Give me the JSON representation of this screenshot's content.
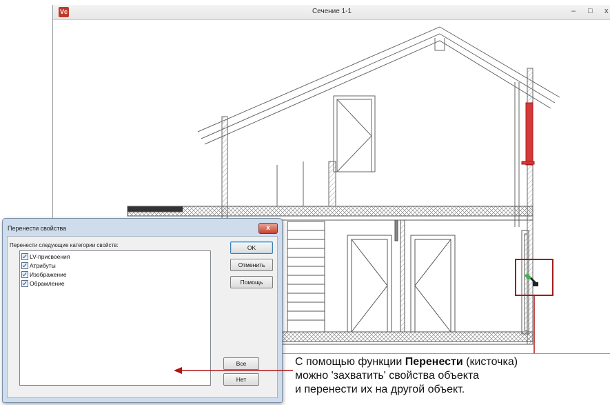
{
  "window": {
    "title": "Сечение 1-1",
    "logo": "Vc",
    "controls": [
      "–",
      "□",
      "x"
    ]
  },
  "dialog": {
    "title": "Перенести свойства",
    "close_symbol": "x",
    "categories_label": "Перенести следующие категории свойств:",
    "categories": [
      {
        "label": "LV-присвоения",
        "checked": true
      },
      {
        "label": "Атрибуты",
        "checked": true
      },
      {
        "label": "Изображение",
        "checked": true
      },
      {
        "label": "Обрамление",
        "checked": true
      }
    ],
    "buttons": {
      "ok": "OK",
      "cancel": "Отменить",
      "help": "Помощь",
      "all": "Все",
      "none": "Нет"
    }
  },
  "annotation": {
    "line1_pre": "С помощью функции ",
    "line1_bold": "Перенести",
    "line1_post": " (кисточка)",
    "line2": "можно 'захватить' свойства объекта",
    "line3": "и перенести их на другой объект."
  },
  "colors": {
    "highlight_red": "#c0392b",
    "arrow_red": "#b01515"
  },
  "icons": [
    "app-logo",
    "minimize-icon",
    "maximize-icon",
    "close-icon",
    "checkbox-icon",
    "brush-cursor-icon"
  ]
}
